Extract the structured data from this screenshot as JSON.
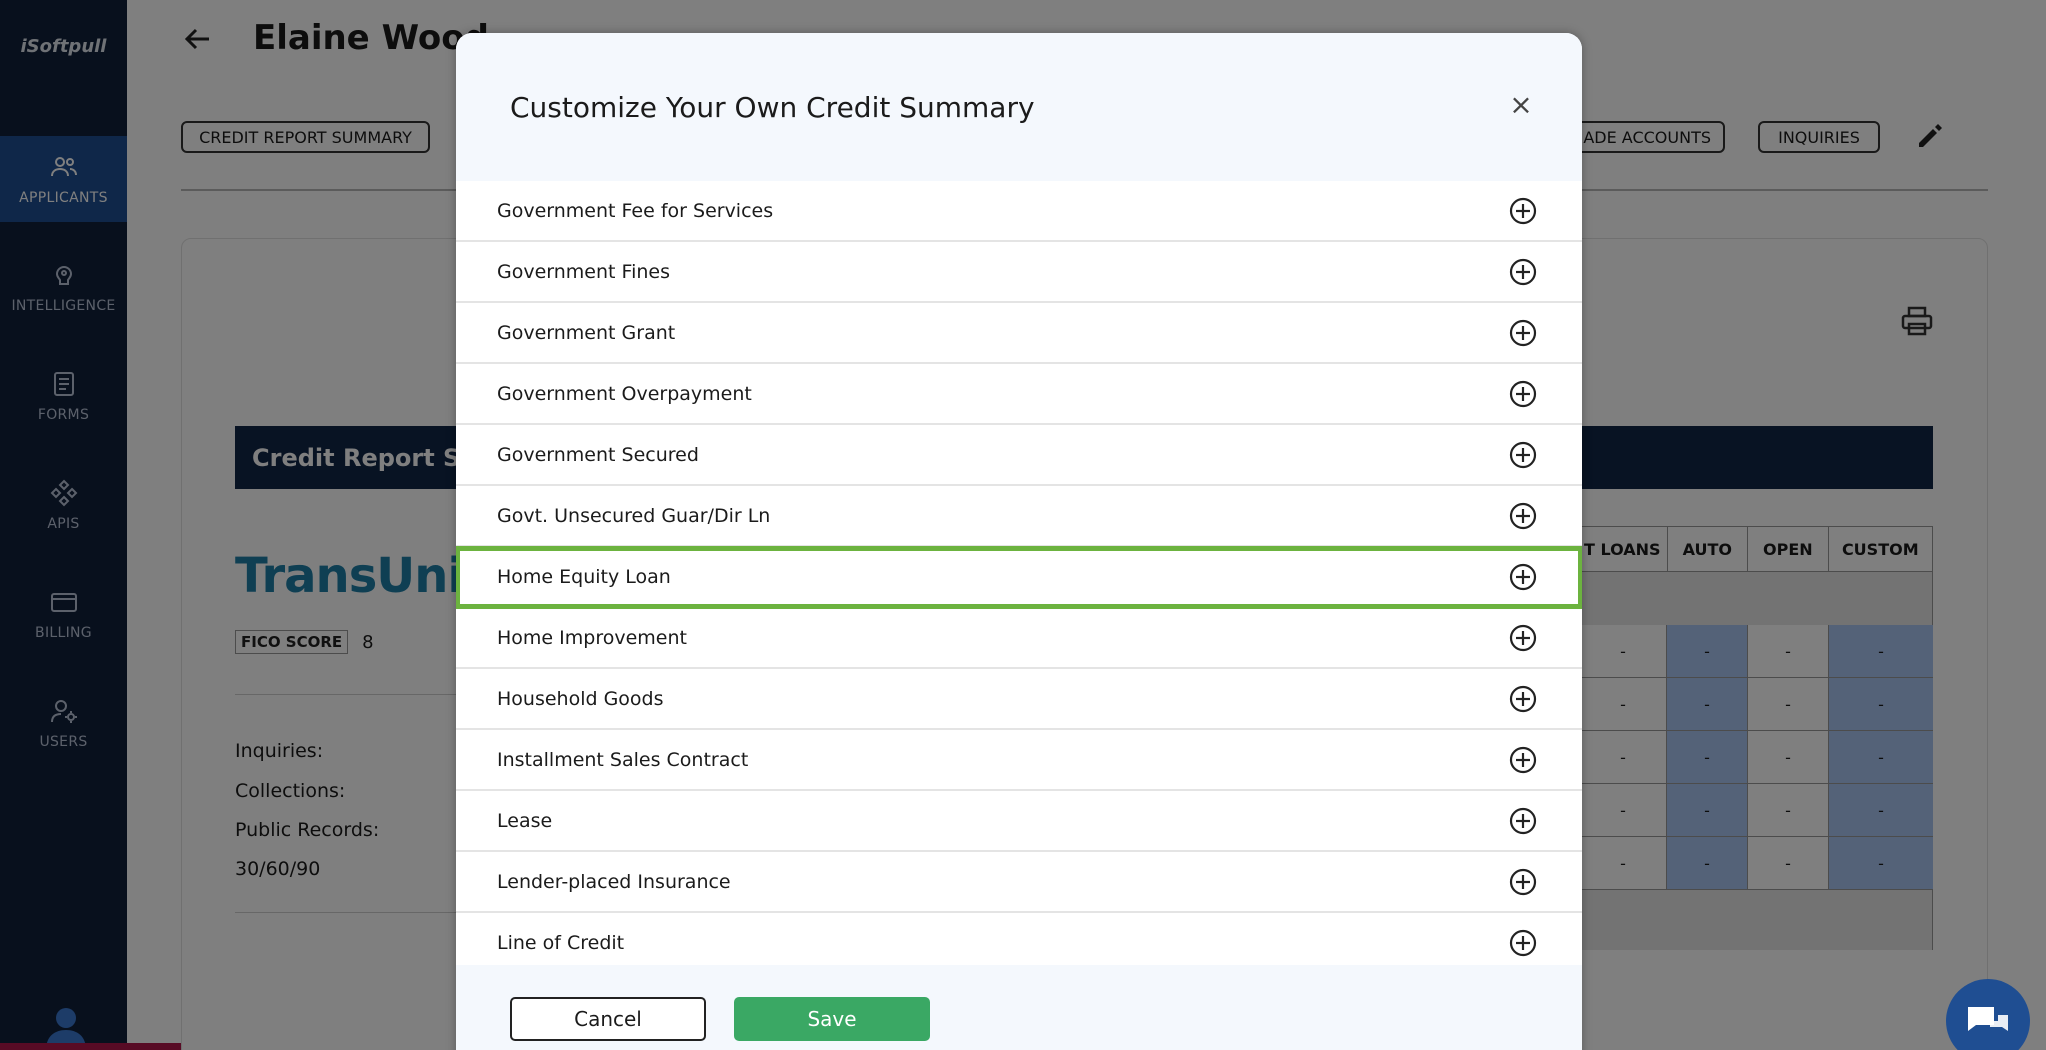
{
  "app": {
    "logo": "iSoftpull"
  },
  "sidebar": {
    "items": [
      {
        "label": "APPLICANTS",
        "icon": "users-icon",
        "active": true
      },
      {
        "label": "INTELLIGENCE",
        "icon": "brain-icon",
        "active": false
      },
      {
        "label": "FORMS",
        "icon": "document-icon",
        "active": false
      },
      {
        "label": "APIS",
        "icon": "api-icon",
        "active": false
      },
      {
        "label": "BILLING",
        "icon": "credit-card-icon",
        "active": false
      },
      {
        "label": "USERS",
        "icon": "user-gear-icon",
        "active": false
      }
    ]
  },
  "page": {
    "title": "Elaine Wood",
    "tabs": [
      "CREDIT REPORT SUMMARY",
      "ADE ACCOUNTS",
      "INQUIRIES"
    ],
    "summary_bar": "Credit Report Summ",
    "bureau": "TransUnio",
    "fico_badge": "FICO SCORE",
    "fico_value": "8",
    "stats": [
      "Inquiries:",
      "Collections:",
      "Public Records:",
      "30/60/90"
    ],
    "table_headers": [
      "T LOANS",
      "AUTO",
      "OPEN",
      "CUSTOM"
    ],
    "table_rows": [
      [
        "-",
        "-",
        "-",
        "-"
      ],
      [
        "-",
        "-",
        "-",
        "-"
      ],
      [
        "-",
        "-",
        "-",
        "-"
      ],
      [
        "-",
        "-",
        "-",
        "-"
      ],
      [
        "-",
        "-",
        "-",
        "-"
      ]
    ]
  },
  "modal": {
    "title": "Customize Your Own Credit Summary",
    "close_label": "×",
    "items": [
      {
        "label": "Government Fee for Services"
      },
      {
        "label": "Government Fines"
      },
      {
        "label": "Government Grant"
      },
      {
        "label": "Government Overpayment"
      },
      {
        "label": "Government Secured"
      },
      {
        "label": "Govt. Unsecured Guar/Dir Ln"
      },
      {
        "label": "Home Equity Loan",
        "highlighted": true
      },
      {
        "label": "Home Improvement"
      },
      {
        "label": "Household Goods"
      },
      {
        "label": "Installment Sales Contract"
      },
      {
        "label": "Lease"
      },
      {
        "label": "Lender-placed Insurance"
      },
      {
        "label": "Line of Credit"
      }
    ],
    "cancel_label": "Cancel",
    "save_label": "Save"
  },
  "colors": {
    "sidebar_bg": "#11213b",
    "active_nav": "#1f4e92",
    "highlight": "#6cb33f",
    "save": "#3aa864",
    "summary_bar": "#112646"
  }
}
